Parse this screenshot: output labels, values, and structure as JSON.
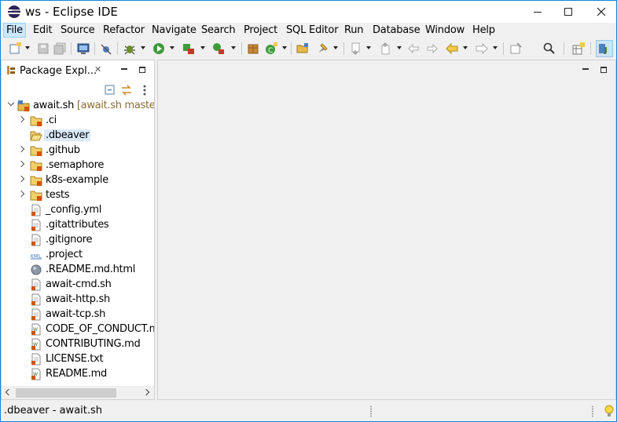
{
  "window": {
    "title": "ws - Eclipse IDE"
  },
  "menu": [
    {
      "label": "File",
      "active": true
    },
    {
      "label": "Edit"
    },
    {
      "label": "Source"
    },
    {
      "label": "Refactor"
    },
    {
      "label": "Navigate"
    },
    {
      "label": "Search"
    },
    {
      "label": "Project"
    },
    {
      "label": "SQL Editor"
    },
    {
      "label": "Run"
    },
    {
      "label": "Database"
    },
    {
      "label": "Window"
    },
    {
      "label": "Help"
    }
  ],
  "package_explorer": {
    "tab_label": "Package Expl...",
    "tree": [
      {
        "label": "await.sh",
        "decoration": "[await.sh master]",
        "icon": "project-icon",
        "expanded": true,
        "level": 0
      },
      {
        "label": ".ci",
        "icon": "folder-icon",
        "expandable": true,
        "level": 1
      },
      {
        "label": ".dbeaver",
        "icon": "open-folder-icon",
        "expandable": false,
        "selected": true,
        "level": 1
      },
      {
        "label": ".github",
        "icon": "folder-icon",
        "expandable": true,
        "level": 1
      },
      {
        "label": ".semaphore",
        "icon": "folder-icon",
        "expandable": true,
        "level": 1
      },
      {
        "label": "k8s-example",
        "icon": "folder-icon",
        "expandable": true,
        "level": 1
      },
      {
        "label": "tests",
        "icon": "folder-icon",
        "expandable": true,
        "level": 1
      },
      {
        "label": "_config.yml",
        "icon": "text-file-icon",
        "level": 1
      },
      {
        "label": ".gitattributes",
        "icon": "text-file-icon",
        "level": 1
      },
      {
        "label": ".gitignore",
        "icon": "text-file-icon",
        "level": 1
      },
      {
        "label": ".project",
        "icon": "xml-file-icon",
        "level": 1
      },
      {
        "label": ".README.md.html",
        "icon": "web-file-icon",
        "level": 1
      },
      {
        "label": "await-cmd.sh",
        "icon": "text-file-icon",
        "level": 1
      },
      {
        "label": "await-http.sh",
        "icon": "text-file-icon",
        "level": 1
      },
      {
        "label": "await-tcp.sh",
        "icon": "text-file-icon",
        "level": 1
      },
      {
        "label": "CODE_OF_CONDUCT.md",
        "icon": "markdown-file-icon",
        "level": 1
      },
      {
        "label": "CONTRIBUTING.md",
        "icon": "markdown-file-icon",
        "level": 1
      },
      {
        "label": "LICENSE.txt",
        "icon": "text-file-icon",
        "level": 1
      },
      {
        "label": "README.md",
        "icon": "markdown-file-icon",
        "level": 1
      }
    ]
  },
  "status": {
    "text": ".dbeaver - await.sh"
  },
  "colors": {
    "accent": "#1883d7",
    "selection": "#dbe9f9",
    "git_decoration": "#8a6b3a"
  }
}
